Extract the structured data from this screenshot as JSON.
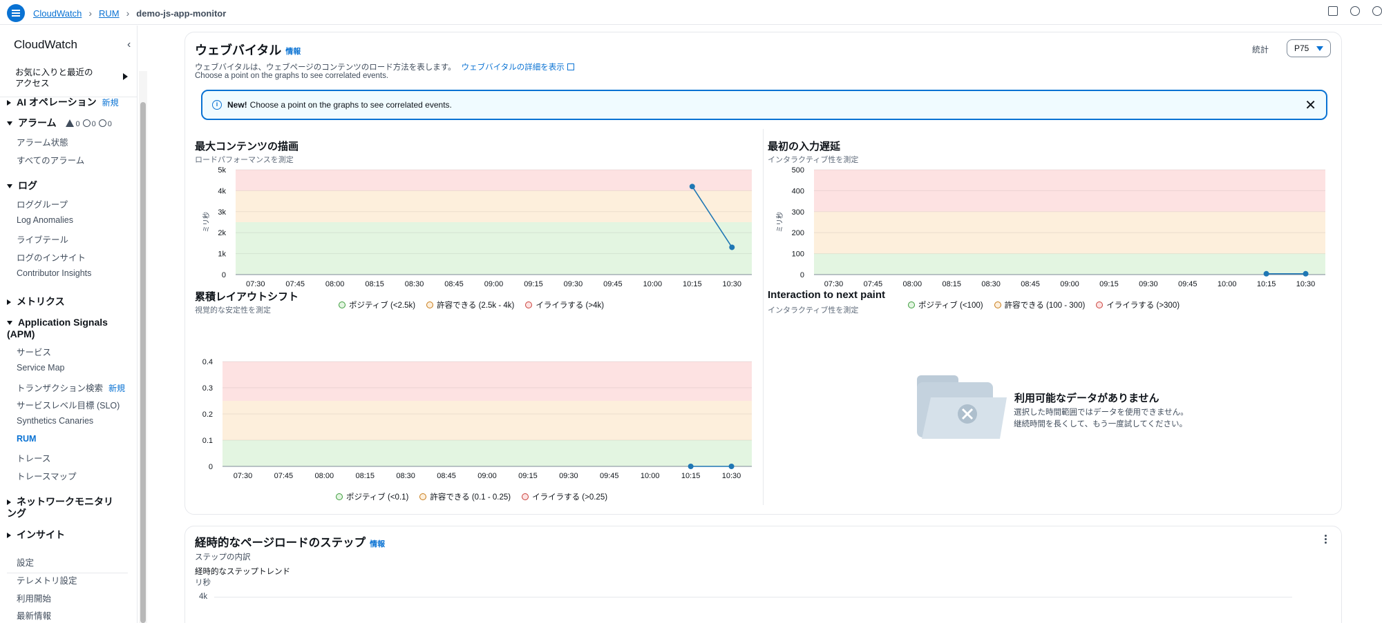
{
  "breadcrumb": {
    "items": [
      "CloudWatch",
      "RUM"
    ],
    "current": "demo-js-app-monitor"
  },
  "sidebar": {
    "title": "CloudWatch",
    "favorites": "お気に入りと最近のアクセス",
    "ai_ops": "AI オペレーション",
    "new_badge": "新規",
    "alarms": {
      "label": "アラーム",
      "warn": "0",
      "ok": "0",
      "other": "0"
    },
    "alarm_items": [
      "アラーム状態",
      "すべてのアラーム"
    ],
    "logs": "ログ",
    "log_items": [
      "ロググループ",
      "Log Anomalies",
      "ライブテール",
      "ログのインサイト",
      "Contributor Insights"
    ],
    "metrics": "メトリクス",
    "apm": "Application Signals (APM)",
    "apm_items": [
      "サービス",
      "Service Map",
      "トランザクション検索",
      "サービスレベル目標 (SLO)",
      "Synthetics Canaries",
      "RUM",
      "トレース",
      "トレースマップ"
    ],
    "network": "ネットワークモニタリング",
    "insights": "インサイト",
    "bottom_items": [
      "設定",
      "テレメトリ設定",
      "利用開始",
      "最新情報"
    ]
  },
  "web_vitals": {
    "title": "ウェブバイタル",
    "info": "情報",
    "desc": "ウェブバイタルは、ウェブページのコンテンツのロード方法を表します。",
    "details_link": "ウェブバイタルの詳細を表示",
    "hint": "Choose a point on the graphs to see correlated events.",
    "stat_label": "統計",
    "stat_value": "P75",
    "flash_new": "New!",
    "flash_text": "Choose a point on the graphs to see correlated events."
  },
  "lcp": {
    "title": "最大コンテンツの描画",
    "subtitle": "ロードパフォーマンスを測定",
    "ylabel": "ミリ秒",
    "legend": [
      "ポジティブ (<2.5k)",
      "許容できる (2.5k - 4k)",
      "イライラする (>4k)"
    ]
  },
  "fid": {
    "title": "最初の入力遅延",
    "subtitle": "インタラクティブ性を測定",
    "ylabel": "ミリ秒",
    "legend": [
      "ポジティブ (<100)",
      "許容できる (100 - 300)",
      "イライラする (>300)"
    ]
  },
  "cls": {
    "title": "累積レイアウトシフト",
    "subtitle": "視覚的な安定性を測定",
    "legend": [
      "ポジティブ (<0.1)",
      "許容できる (0.1 - 0.25)",
      "イライラする (>0.25)"
    ]
  },
  "inp": {
    "title": "Interaction to next paint",
    "subtitle": "インタラクティブ性を測定",
    "nodata_title": "利用可能なデータがありません",
    "nodata_line1": "選択した時間範囲ではデータを使用できません。",
    "nodata_line2": "継続時間を長くして、もう一度試してください。"
  },
  "page_load": {
    "title": "経時的なページロードのステップ",
    "info": "情報",
    "subtitle": "ステップの内訳",
    "trend": "経時的なステップトレンド",
    "ylabel": "リ秒",
    "ytick": "4k"
  },
  "chart_data": [
    {
      "type": "line",
      "title": "最大コンテンツの描画",
      "ylabel": "ミリ秒",
      "x": [
        "07:30",
        "07:45",
        "08:00",
        "08:15",
        "08:30",
        "08:45",
        "09:00",
        "09:15",
        "09:30",
        "09:45",
        "10:00",
        "10:15",
        "10:30"
      ],
      "yticks": [
        "0",
        "1k",
        "2k",
        "3k",
        "4k",
        "5k"
      ],
      "ylim": [
        0,
        5000
      ],
      "bands": [
        2500,
        4000
      ],
      "colors": {
        "line": "#1f77b4",
        "good": "#e3f5e1",
        "ok": "#fdefdc",
        "bad": "#fde2e2"
      },
      "series": [
        {
          "x": [
            "10:15",
            "10:30"
          ],
          "values": [
            4200,
            1300
          ]
        }
      ]
    },
    {
      "type": "line",
      "title": "最初の入力遅延",
      "ylabel": "ミリ秒",
      "x": [
        "07:30",
        "07:45",
        "08:00",
        "08:15",
        "08:30",
        "08:45",
        "09:00",
        "09:15",
        "09:30",
        "09:45",
        "10:00",
        "10:15",
        "10:30"
      ],
      "yticks": [
        "0",
        "100",
        "200",
        "300",
        "400",
        "500"
      ],
      "ylim": [
        0,
        500
      ],
      "bands": [
        100,
        300
      ],
      "series": [
        {
          "x": [
            "10:15",
            "10:30"
          ],
          "values": [
            4,
            4
          ]
        }
      ]
    },
    {
      "type": "line",
      "title": "累積レイアウトシフト",
      "x": [
        "07:30",
        "07:45",
        "08:00",
        "08:15",
        "08:30",
        "08:45",
        "09:00",
        "09:15",
        "09:30",
        "09:45",
        "10:00",
        "10:15",
        "10:30"
      ],
      "yticks": [
        "0",
        "0.1",
        "0.2",
        "0.3",
        "0.4"
      ],
      "ylim": [
        0,
        0.4
      ],
      "bands": [
        0.1,
        0.25
      ],
      "series": [
        {
          "x": [
            "10:15",
            "10:30"
          ],
          "values": [
            0,
            0
          ]
        }
      ]
    }
  ]
}
